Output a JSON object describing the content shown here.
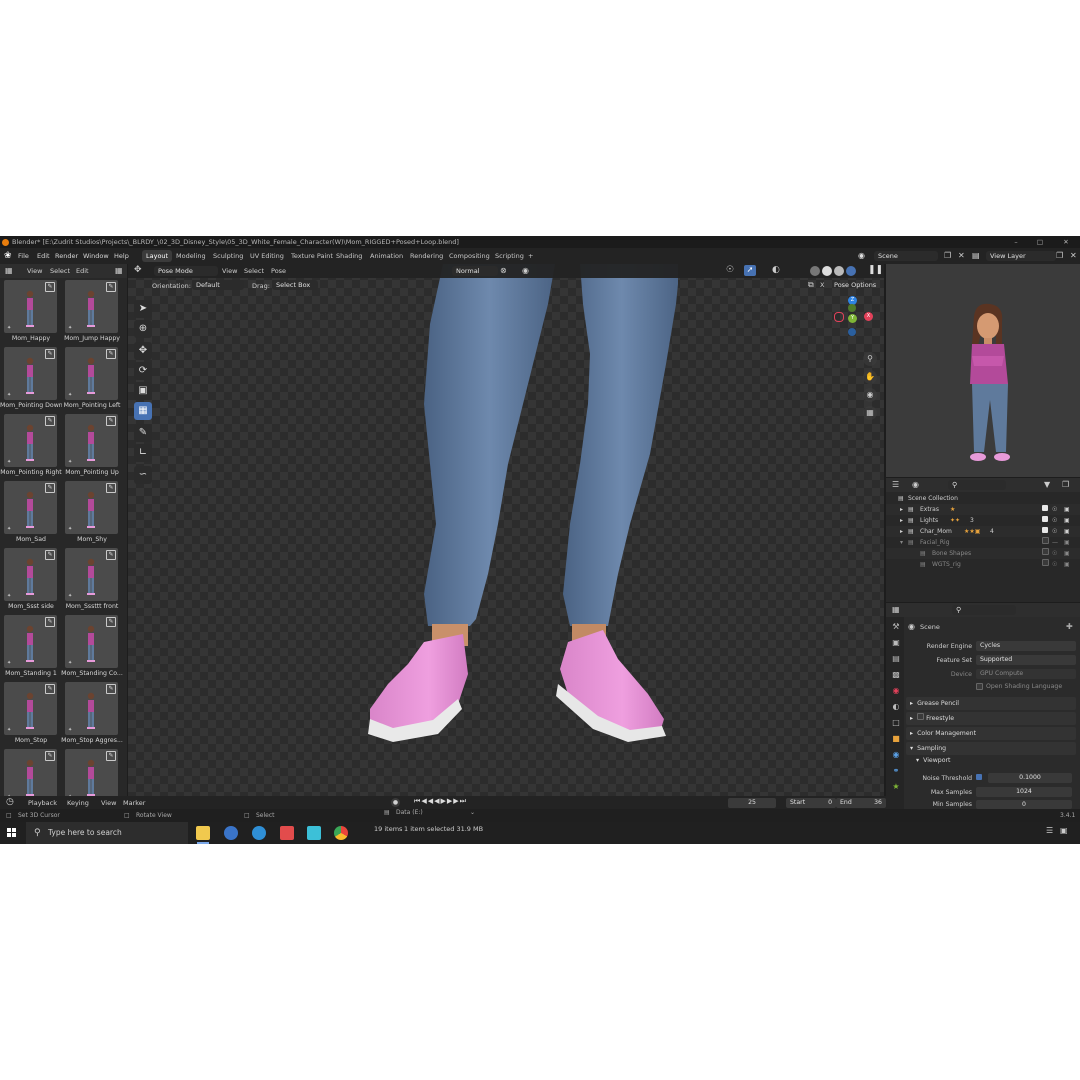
{
  "window": {
    "title": "Blender* [E:\\Zudrit Studios\\Projects\\_BLRDY_\\02_3D_Disney_Style\\05_3D_White_Female_Character(W)\\Mom_RIGGED+Posed+Loop.blend]"
  },
  "menu": [
    "File",
    "Edit",
    "Render",
    "Window",
    "Help"
  ],
  "workspaces": [
    "Layout",
    "Modeling",
    "Sculpting",
    "UV Editing",
    "Texture Paint",
    "Shading",
    "Animation",
    "Rendering",
    "Compositing",
    "Scripting"
  ],
  "workspace_add": "+",
  "scene": {
    "name": "Scene",
    "view_layer": "View Layer"
  },
  "asset_panel": {
    "header": [
      "View",
      "Select",
      "Edit"
    ],
    "items": [
      {
        "label": "Mom_Happy"
      },
      {
        "label": "Mom_Jump Happy"
      },
      {
        "label": "Mom_Pointing Down"
      },
      {
        "label": "Mom_Pointing Left"
      },
      {
        "label": "Mom_Pointing Right"
      },
      {
        "label": "Mom_Pointing Up"
      },
      {
        "label": "Mom_Sad"
      },
      {
        "label": "Mom_Shy"
      },
      {
        "label": "Mom_Ssst side"
      },
      {
        "label": "Mom_Sssttt front"
      },
      {
        "label": "Mom_Standing 1"
      },
      {
        "label": "Mom_Standing Co..."
      },
      {
        "label": "Mom_Stop"
      },
      {
        "label": "Mom_Stop Aggres..."
      },
      {
        "label": ""
      },
      {
        "label": ""
      }
    ]
  },
  "viewport": {
    "mode": "Pose Mode",
    "header_menus": [
      "View",
      "Select",
      "Pose"
    ],
    "transform_orientation": "Normal",
    "orientation_label": "Orientation:",
    "orientation_value": "Default",
    "drag_label": "Drag:",
    "drag_value": "Select Box",
    "pose_options": "Pose Options",
    "x_label": "X"
  },
  "outliner": {
    "rows": [
      {
        "label": "Scene Collection"
      },
      {
        "label": "Extras"
      },
      {
        "label": "Lights"
      },
      {
        "label": "Char_Mom"
      },
      {
        "label": "Facial_Rig"
      },
      {
        "label": "Bone Shapes"
      },
      {
        "label": "WGTS_rig"
      }
    ],
    "lights_count": "3",
    "char_count": "4"
  },
  "properties": {
    "context": "Scene",
    "render_engine_label": "Render Engine",
    "render_engine": "Cycles",
    "feature_set_label": "Feature Set",
    "feature_set": "Supported",
    "device_label": "Device",
    "device": "GPU Compute",
    "osl_label": "Open Shading Language",
    "sections": [
      "Grease Pencil",
      "Freestyle",
      "Color Management",
      "Sampling"
    ],
    "viewport_sub": "Viewport",
    "noise_threshold_label": "Noise Threshold",
    "noise_threshold": "0.1000",
    "max_samples_label": "Max Samples",
    "max_samples": "1024",
    "min_samples_label": "Min Samples",
    "min_samples": "0"
  },
  "timeline": {
    "menus": [
      "Playback",
      "Keying",
      "View",
      "Marker"
    ],
    "current_frame": "25",
    "start_label": "Start",
    "start": "0",
    "end_label": "End",
    "end": "36"
  },
  "statusbar": {
    "left": "Set 3D Cursor",
    "middle": "Rotate View",
    "right": "Select",
    "version": "3.4.1",
    "explorer_location": "Data (E:)",
    "explorer_items": "19 items",
    "explorer_selected": "1 item selected  31.9 MB"
  },
  "taskbar": {
    "search_placeholder": "Type here to search"
  },
  "colors": {
    "accent": "#4772b3",
    "shoe": "#e79ad9",
    "jeans": "#5f7a9c",
    "shirt": "#b34a9a"
  }
}
